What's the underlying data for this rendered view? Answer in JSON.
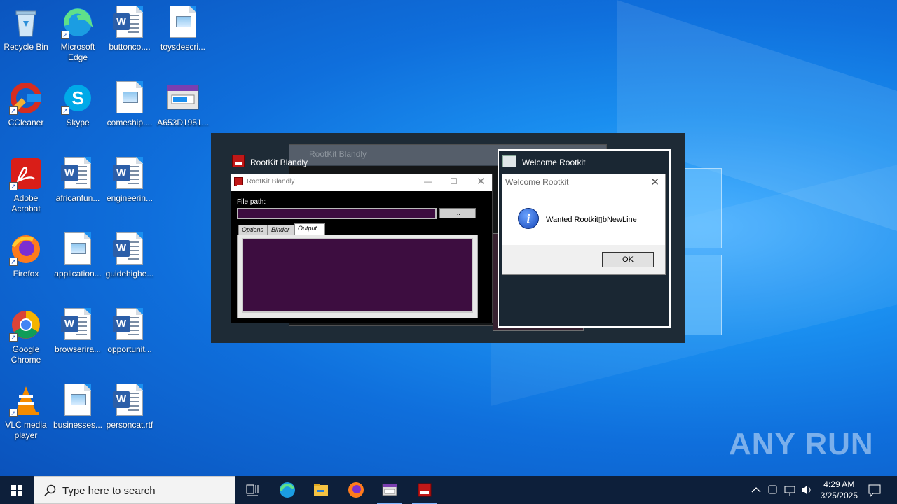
{
  "desktop": {
    "icons": [
      {
        "label": "Recycle Bin",
        "kind": "recycle-bin"
      },
      {
        "label": "Microsoft Edge",
        "kind": "edge"
      },
      {
        "label": "buttonco....",
        "kind": "word-doc"
      },
      {
        "label": "toysdescri...",
        "kind": "image-doc"
      },
      {
        "label": "CCleaner",
        "kind": "ccleaner"
      },
      {
        "label": "Skype",
        "kind": "skype"
      },
      {
        "label": "comeship....",
        "kind": "image-doc"
      },
      {
        "label": "A653D1951...",
        "kind": "installer"
      },
      {
        "label": "Adobe Acrobat",
        "kind": "acrobat"
      },
      {
        "label": "africanfun...",
        "kind": "word-doc"
      },
      {
        "label": "engineerin...",
        "kind": "word-doc"
      },
      {
        "label": "Firefox",
        "kind": "firefox"
      },
      {
        "label": "application...",
        "kind": "image-doc"
      },
      {
        "label": "guidehighe...",
        "kind": "word-doc"
      },
      {
        "label": "Google Chrome",
        "kind": "chrome"
      },
      {
        "label": "browserira...",
        "kind": "word-doc"
      },
      {
        "label": "opportunit...",
        "kind": "word-doc"
      },
      {
        "label": "VLC media player",
        "kind": "vlc"
      },
      {
        "label": "businesses...",
        "kind": "image-doc"
      },
      {
        "label": "personcat.rtf",
        "kind": "word-doc"
      }
    ]
  },
  "rootkit": {
    "caption": "RootKit Blandly",
    "window_title": "RootKit Blandly",
    "ghost_title": "RootKit Blandly",
    "file_path_label": "File path:",
    "file_path_value": "",
    "browse_label": "...",
    "tabs": [
      "Options",
      "Binder",
      "Output"
    ],
    "active_tab": "Output"
  },
  "dialog": {
    "caption": "Welcome Rootkit",
    "title": "Welcome Rootkit",
    "message": "Wanted Rootkit▯bNewLine",
    "ok_label": "OK"
  },
  "taskbar": {
    "search_placeholder": "Type here to search",
    "time": "4:29 AM",
    "date": "3/25/2025"
  },
  "watermark": "ANY RUN"
}
